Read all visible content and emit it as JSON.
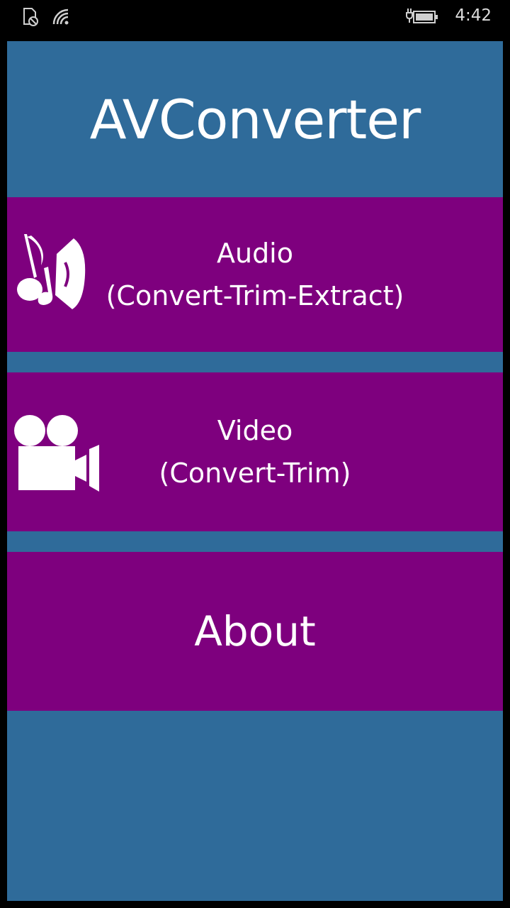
{
  "status_bar": {
    "time": "4:42",
    "icons": [
      "no-sim-icon",
      "wifi-icon",
      "battery-charging-icon"
    ]
  },
  "app": {
    "title": "AVConverter",
    "background_color": "#2f6b9a",
    "button_color": "#7e007e"
  },
  "menu": {
    "audio": {
      "label": "Audio",
      "sublabel": "(Convert-Trim-Extract)",
      "icon": "audio-speaker-icon"
    },
    "video": {
      "label": "Video",
      "sublabel": "(Convert-Trim)",
      "icon": "video-camera-icon"
    },
    "about": {
      "label": "About"
    }
  }
}
